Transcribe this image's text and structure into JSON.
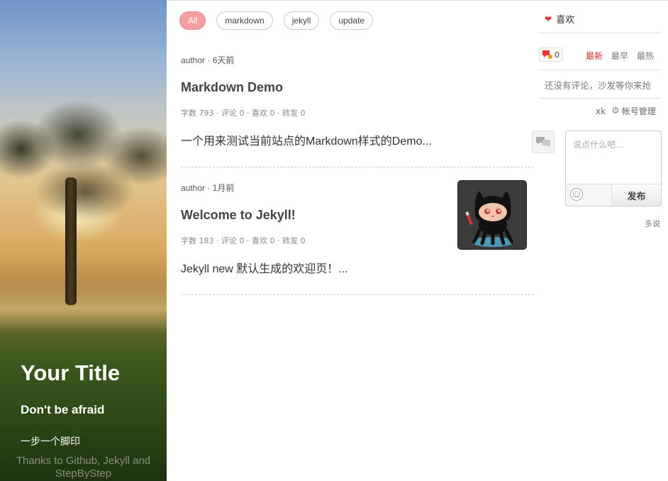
{
  "hero": {
    "title": "Your Title",
    "subtitle": "Don't be afraid",
    "motto": "一步一个脚印",
    "credits": "Thanks to Github, Jekyll and StepByStep"
  },
  "tags": [
    {
      "label": "All",
      "active": true
    },
    {
      "label": "markdown",
      "active": false
    },
    {
      "label": "jekyll",
      "active": false
    },
    {
      "label": "update",
      "active": false
    }
  ],
  "posts": [
    {
      "meta": "author · 6天前",
      "title": "Markdown Demo",
      "stats": "字数 793 · 评论 0 · 喜欢 0 · 转发 0",
      "excerpt": "一个用来测试当前站点的Markdown样式的Demo..."
    },
    {
      "meta": "author · 1月前",
      "title": "Welcome to Jekyll!",
      "stats": "字数 183 · 评论 0 · 喜欢 0 · 转发 0",
      "excerpt": "Jekyll new 默认生成的欢迎页！...",
      "thumbnail_icon": "octocat-icon"
    }
  ],
  "comments": {
    "like_label": "喜欢",
    "count": "0",
    "sort": {
      "newest": "最新",
      "oldest": "最早",
      "hottest": "最热"
    },
    "empty_text": "还没有评论，沙发等你来抢",
    "username": "xk",
    "account_label": "帐号管理",
    "placeholder": "说点什么吧…",
    "publish_label": "发布",
    "powered_by": "多说"
  },
  "colors": {
    "accent": "#f4a0a0",
    "sort_active": "#cc3333",
    "heart": "#ee3333"
  }
}
